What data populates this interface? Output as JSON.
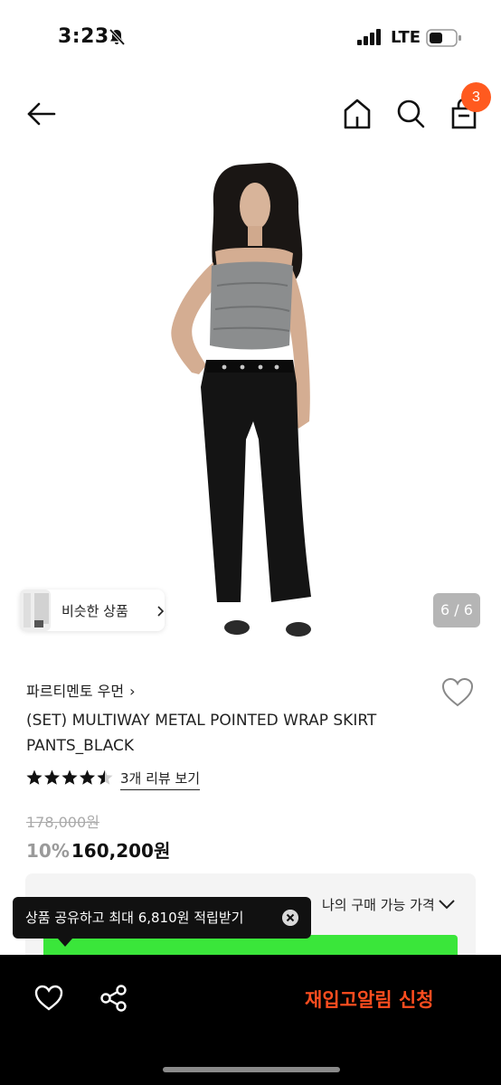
{
  "status_bar": {
    "time": "3:23",
    "network": "LTE",
    "icons": [
      "bell-slash-icon",
      "signal-icon",
      "battery-icon"
    ]
  },
  "nav": {
    "cart_count": "3",
    "icons": [
      "back-arrow-icon",
      "home-icon",
      "search-icon",
      "shopping-bag-icon"
    ]
  },
  "gallery": {
    "similar_label": "비슷한 상품",
    "page_indicator": "6 / 6"
  },
  "product": {
    "brand": "파르티멘토 우먼",
    "title": "(SET) MULTIWAY METAL POINTED WRAP SKIRT PANTS_BLACK",
    "rating": 4.5,
    "review_link": "3개 리뷰 보기",
    "original_price": "178,000원",
    "discount": "10%",
    "price": "160,200원"
  },
  "benefit_panel": {
    "peek_text": "나의 구매 가능 가격"
  },
  "tooltip": {
    "text": "상품 공유하고 최대 6,810원 적립받기"
  },
  "bottom_bar": {
    "restock_label": "재입고알림 신청"
  },
  "colors": {
    "accent": "#ff5a1f",
    "restock": "#ff4d1f",
    "discount": "#9a9a9a",
    "green_banner": "#3ae63a"
  }
}
